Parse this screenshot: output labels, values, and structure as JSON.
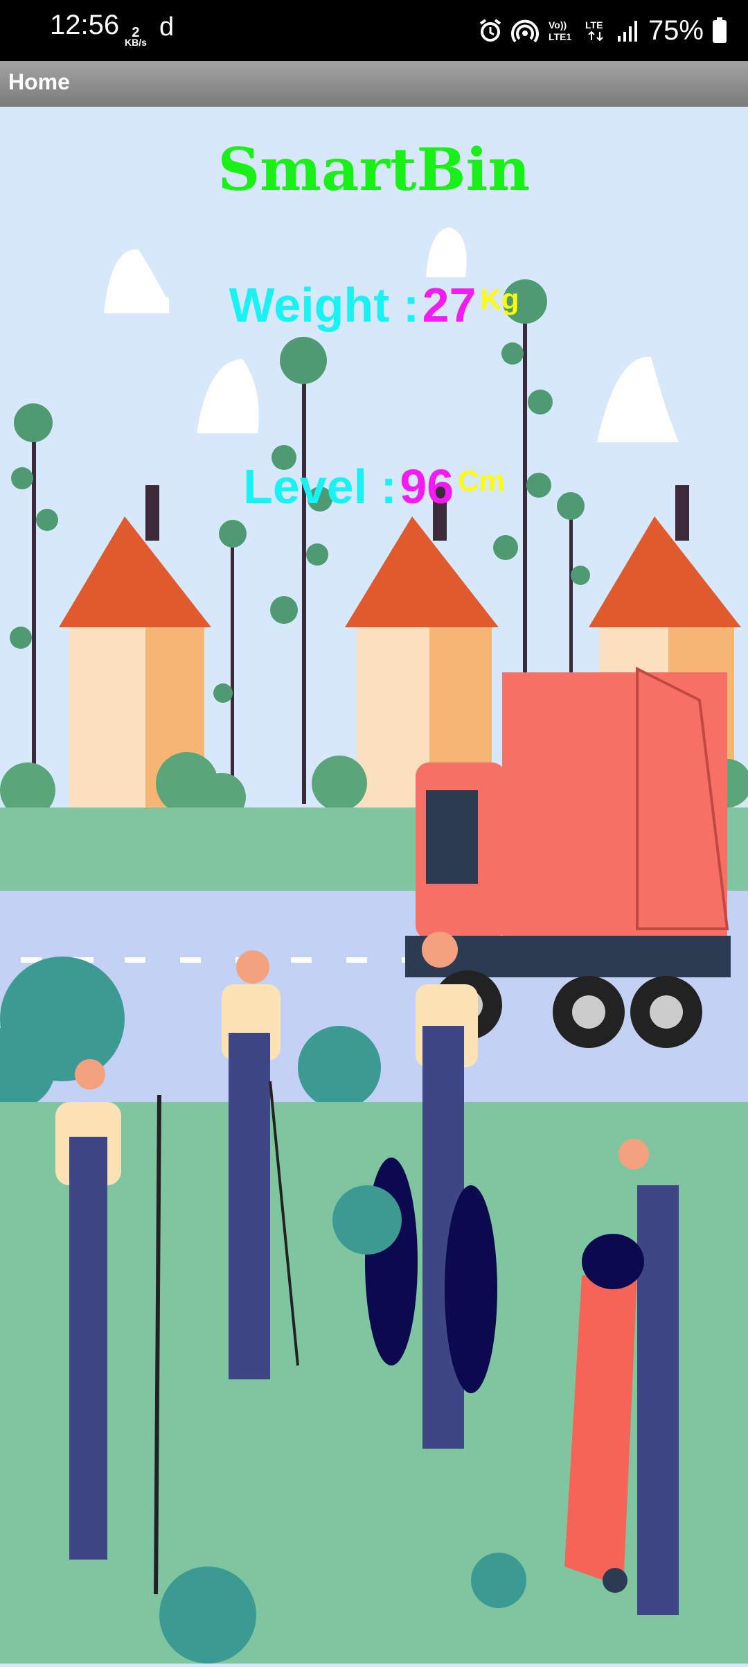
{
  "status_bar": {
    "time": "12:56",
    "net_speed_value": "2",
    "net_speed_unit": "KB/s",
    "app_glyph": "d",
    "battery": "75%",
    "icons": [
      "alarm-icon",
      "hotspot-icon",
      "volte-icon",
      "lte-icon",
      "signal-icon",
      "battery-icon"
    ]
  },
  "app_bar": {
    "title": "Home"
  },
  "main": {
    "title": "SmartBin",
    "weight": {
      "label": "Weight :",
      "value": "27",
      "unit": "Kg"
    },
    "level": {
      "label": "Level :",
      "value": "96",
      "unit": "Cm"
    }
  },
  "colors": {
    "title": "#18f018",
    "label": "#19f2f2",
    "value": "#f21bf2",
    "unit": "#ffff00"
  }
}
